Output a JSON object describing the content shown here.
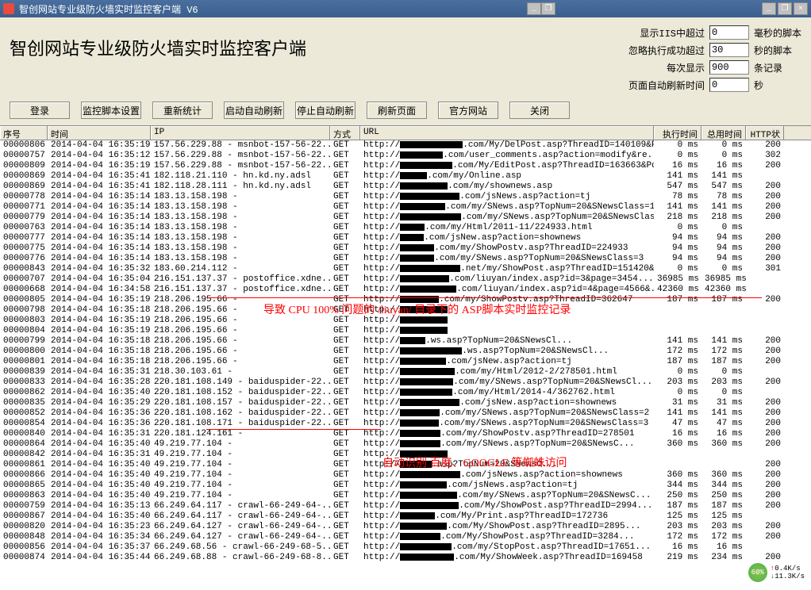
{
  "window": {
    "title": "智创网站专业级防火墙实时监控客户端  V6",
    "minimize": "_",
    "restore": "❐",
    "close": "×",
    "float_min": "_",
    "float_rest": "❐"
  },
  "header": {
    "title": "智创网站专业级防火墙实时监控客户端"
  },
  "settings": {
    "r1_label": "显示IIS中超过",
    "r1_value": "0",
    "r1_unit": "毫秒的脚本",
    "r2_label": "忽略执行成功超过",
    "r2_value": "30",
    "r2_unit": "秒的脚本",
    "r3_label": "每次显示",
    "r3_value": "900",
    "r3_unit": "条记录",
    "r4_label": "页面自动刷新时间",
    "r4_value": "0",
    "r4_unit": "秒"
  },
  "toolbar": {
    "login": "登录",
    "script": "监控脚本设置",
    "restat": "重新统计",
    "startauto": "启动自动刷新",
    "stopauto": "停止自动刷新",
    "refresh": "刷新页面",
    "site": "官方网站",
    "close": "关闭"
  },
  "columns": {
    "seq": "序号",
    "time": "时间",
    "ip": "IP",
    "method": "方式",
    "url": "URL",
    "exec": "执行时间",
    "total": "总用时间",
    "status": "HTTP状"
  },
  "annotations": {
    "note1": "导致 CPU 100% 问题的 /liuyan/ 目录下的 ASP脚本实时监控记录",
    "note2": "自动识别 百度、GOOGLE 等蜘蛛访问"
  },
  "badge": {
    "pct": "60%",
    "up": "0.4K/s",
    "down": "11.3K/s"
  },
  "rows": [
    {
      "seq": "00000806",
      "time": "2014-04-04 16:35:19",
      "ip": "157.56.229.88 - msnbot-157-56-22...",
      "m": "GET",
      "url": "com/My/DelPost.asp?ThreadID=140109&Pag...",
      "e": "0 ms",
      "t": "0 ms",
      "s": "200"
    },
    {
      "seq": "00000757",
      "time": "2014-04-04 16:35:12",
      "ip": "157.56.229.88 - msnbot-157-56-22...",
      "m": "GET",
      "url": "com/user_comments.asp?action=modify&re...",
      "e": "0 ms",
      "t": "0 ms",
      "s": "302"
    },
    {
      "seq": "00000809",
      "time": "2014-04-04 16:35:19",
      "ip": "157.56.229.88 - msnbot-157-56-22...",
      "m": "GET",
      "url": "com/My/EditPost.asp?ThreadID=163663&Po...",
      "e": "16 ms",
      "t": "16 ms",
      "s": "200"
    },
    {
      "seq": "00000869",
      "time": "2014-04-04 16:35:41",
      "ip": "182.118.21.110 - hn.kd.ny.adsl",
      "m": "GET",
      "url": "com/my/Online.asp",
      "e": "141 ms",
      "t": "141 ms",
      "s": ""
    },
    {
      "seq": "00000869",
      "time": "2014-04-04 16:35:41",
      "ip": "182.118.28.111 - hn.kd.ny.adsl",
      "m": "GET",
      "url": "com/my/shownews.asp",
      "e": "547 ms",
      "t": "547 ms",
      "s": "200"
    },
    {
      "seq": "00000778",
      "time": "2014-04-04 16:35:14",
      "ip": "183.13.158.198 -",
      "m": "GET",
      "url": "com/jsNews.asp?action=tj",
      "e": "78 ms",
      "t": "78 ms",
      "s": "200"
    },
    {
      "seq": "00000771",
      "time": "2014-04-04 16:35:14",
      "ip": "183.13.158.198 -",
      "m": "GET",
      "url": "com/my/SNews.asp?TopNum=20&SNewsClass=1",
      "e": "141 ms",
      "t": "141 ms",
      "s": "200"
    },
    {
      "seq": "00000779",
      "time": "2014-04-04 16:35:14",
      "ip": "183.13.158.198 -",
      "m": "GET",
      "url": "com/my/SNews.asp?TopNum=20&SNewsClass=2",
      "e": "218 ms",
      "t": "218 ms",
      "s": "200"
    },
    {
      "seq": "00000763",
      "time": "2014-04-04 16:35:14",
      "ip": "183.13.158.198 -",
      "m": "GET",
      "url": "com/my/Html/2011-11/224933.html",
      "e": "0 ms",
      "t": "0 ms",
      "s": ""
    },
    {
      "seq": "00000777",
      "time": "2014-04-04 16:35:14",
      "ip": "183.13.158.198 -",
      "m": "GET",
      "url": "com/jsNew.asp?action=shownews",
      "e": "94 ms",
      "t": "94 ms",
      "s": "200"
    },
    {
      "seq": "00000775",
      "time": "2014-04-04 16:35:14",
      "ip": "183.13.158.198 -",
      "m": "GET",
      "url": "com/my/ShowPostv.asp?ThreadID=224933",
      "e": "94 ms",
      "t": "94 ms",
      "s": "200"
    },
    {
      "seq": "00000776",
      "time": "2014-04-04 16:35:14",
      "ip": "183.13.158.198 -",
      "m": "GET",
      "url": "com/my/SNews.asp?TopNum=20&SNewsClass=3",
      "e": "94 ms",
      "t": "94 ms",
      "s": "200"
    },
    {
      "seq": "00000843",
      "time": "2014-04-04 16:35:32",
      "ip": "183.60.214.112 -",
      "m": "GET",
      "url": "net/my/ShowPost.asp?ThreadID=151420&G...",
      "e": "0 ms",
      "t": "0 ms",
      "s": "301"
    },
    {
      "seq": "00000707",
      "time": "2014-04-04 16:35:04",
      "ip": "216.151.137.37 - postoffice.xdne...",
      "m": "GET",
      "url": "com/liuyan/index.asp?id=3&page=3454...",
      "e": "36985 ms",
      "t": "36985 ms",
      "s": ""
    },
    {
      "seq": "00000668",
      "time": "2014-04-04 16:34:58",
      "ip": "216.151.137.37 - postoffice.xdne...",
      "m": "GET",
      "url": "com/liuyan/index.asp?id=4&page=4566&...",
      "e": "42360 ms",
      "t": "42360 ms",
      "s": ""
    },
    {
      "seq": "00000805",
      "time": "2014-04-04 16:35:19",
      "ip": "218.206.195.66 -",
      "m": "GET",
      "url": "com/my/ShowPostv.asp?ThreadID=362647",
      "e": "187 ms",
      "t": "187 ms",
      "s": "200"
    },
    {
      "seq": "00000798",
      "time": "2014-04-04 16:35:18",
      "ip": "218.206.195.66 -",
      "m": "GET",
      "url": "",
      "e": "",
      "t": "",
      "s": ""
    },
    {
      "seq": "00000803",
      "time": "2014-04-04 16:35:19",
      "ip": "218.206.195.66 -",
      "m": "GET",
      "url": "",
      "e": "",
      "t": "",
      "s": ""
    },
    {
      "seq": "00000804",
      "time": "2014-04-04 16:35:19",
      "ip": "218.206.195.66 -",
      "m": "GET",
      "url": "",
      "e": "",
      "t": "",
      "s": ""
    },
    {
      "seq": "00000799",
      "time": "2014-04-04 16:35:18",
      "ip": "218.206.195.66 -",
      "m": "GET",
      "url": "ws.asp?TopNum=20&SNewsCl...",
      "e": "141 ms",
      "t": "141 ms",
      "s": "200"
    },
    {
      "seq": "00000800",
      "time": "2014-04-04 16:35:18",
      "ip": "218.206.195.66 -",
      "m": "GET",
      "url": "ws.asp?TopNum=20&SNewsCl...",
      "e": "172 ms",
      "t": "172 ms",
      "s": "200"
    },
    {
      "seq": "00000801",
      "time": "2014-04-04 16:35:18",
      "ip": "218.206.195.66 -",
      "m": "GET",
      "url": "com/jsNew.asp?action=tj",
      "e": "187 ms",
      "t": "187 ms",
      "s": "200"
    },
    {
      "seq": "00000839",
      "time": "2014-04-04 16:35:31",
      "ip": "218.30.103.61 -",
      "m": "GET",
      "url": "com/my/Html/2012-2/278501.html",
      "e": "0 ms",
      "t": "0 ms",
      "s": ""
    },
    {
      "seq": "00000833",
      "time": "2014-04-04 16:35:28",
      "ip": "220.181.108.149 - baiduspider-22...",
      "m": "GET",
      "url": "com/my/SNews.asp?TopNum=20&SNewsCl...",
      "e": "203 ms",
      "t": "203 ms",
      "s": "200"
    },
    {
      "seq": "00000862",
      "time": "2014-04-04 16:35:40",
      "ip": "220.181.108.152 - baiduspider-22...",
      "m": "GET",
      "url": "com/my/Html/2014-4/362762.html",
      "e": "0 ms",
      "t": "0 ms",
      "s": ""
    },
    {
      "seq": "00000835",
      "time": "2014-04-04 16:35:29",
      "ip": "220.181.108.157 - baiduspider-22...",
      "m": "GET",
      "url": "com/jsNew.asp?action=shownews",
      "e": "31 ms",
      "t": "31 ms",
      "s": "200"
    },
    {
      "seq": "00000852",
      "time": "2014-04-04 16:35:36",
      "ip": "220.181.108.162 - baiduspider-22...",
      "m": "GET",
      "url": "com/my/SNews.asp?TopNum=20&SNewsClass=2",
      "e": "141 ms",
      "t": "141 ms",
      "s": "200"
    },
    {
      "seq": "00000854",
      "time": "2014-04-04 16:35:36",
      "ip": "220.181.108.171 - baiduspider-22...",
      "m": "GET",
      "url": "com/my/SNews.asp?TopNum=20&SNewsClass=3",
      "e": "47 ms",
      "t": "47 ms",
      "s": "200"
    },
    {
      "seq": "00000840",
      "time": "2014-04-04 16:35:31",
      "ip": "220.181.124.161 -",
      "m": "GET",
      "url": "com/my/ShowPostv.asp?ThreadID=278501",
      "e": "16 ms",
      "t": "16 ms",
      "s": "200"
    },
    {
      "seq": "00000864",
      "time": "2014-04-04 16:35:40",
      "ip": "49.219.77.104 -",
      "m": "GET",
      "url": "com/my/SNews.asp?TopNum=20&SNewsC...",
      "e": "360 ms",
      "t": "360 ms",
      "s": "200"
    },
    {
      "seq": "00000842",
      "time": "2014-04-04 16:35:31",
      "ip": "49.219.77.104 -",
      "m": "GET",
      "url": "",
      "e": "",
      "t": "",
      "s": ""
    },
    {
      "seq": "00000861",
      "time": "2014-04-04 16:35:40",
      "ip": "49.219.77.104 -",
      "m": "GET",
      "url": "asp?TopNum=20&SNewsC...",
      "e": "",
      "t": "",
      "s": "200"
    },
    {
      "seq": "00000866",
      "time": "2014-04-04 16:35:40",
      "ip": "49.219.77.104 -",
      "m": "GET",
      "url": "com/jsNews.asp?action=shownews",
      "e": "360 ms",
      "t": "360 ms",
      "s": "200"
    },
    {
      "seq": "00000865",
      "time": "2014-04-04 16:35:40",
      "ip": "49.219.77.104 -",
      "m": "GET",
      "url": "com/jsNews.asp?action=tj",
      "e": "344 ms",
      "t": "344 ms",
      "s": "200"
    },
    {
      "seq": "00000863",
      "time": "2014-04-04 16:35:40",
      "ip": "49.219.77.104 -",
      "m": "GET",
      "url": "com/my/SNews.asp?TopNum=20&SNewsC...",
      "e": "250 ms",
      "t": "250 ms",
      "s": "200"
    },
    {
      "seq": "00000759",
      "time": "2014-04-04 16:35:13",
      "ip": "66.249.64.117 - crawl-66-249-64-...",
      "m": "GET",
      "url": "com/My/ShowPost.asp?ThreadID=2994...",
      "e": "187 ms",
      "t": "187 ms",
      "s": "200"
    },
    {
      "seq": "00000867",
      "time": "2014-04-04 16:35:40",
      "ip": "66.249.64.117 - crawl-66-249-64-...",
      "m": "GET",
      "url": "com/My/Print.asp?ThreadID=172736",
      "e": "125 ms",
      "t": "125 ms",
      "s": ""
    },
    {
      "seq": "00000820",
      "time": "2014-04-04 16:35:23",
      "ip": "66.249.64.127 - crawl-66-249-64-...",
      "m": "GET",
      "url": "com/My/ShowPost.asp?ThreadID=2895...",
      "e": "203 ms",
      "t": "203 ms",
      "s": "200"
    },
    {
      "seq": "00000848",
      "time": "2014-04-04 16:35:34",
      "ip": "66.249.64.127 - crawl-66-249-64-...",
      "m": "GET",
      "url": "com/My/ShowPost.asp?ThreadID=3284...",
      "e": "172 ms",
      "t": "172 ms",
      "s": "200"
    },
    {
      "seq": "00000856",
      "time": "2014-04-04 16:35:37",
      "ip": "66.249.68.56 - crawl-66-249-68-5...",
      "m": "GET",
      "url": "com/my/StopPost.asp?ThreadID=17651...",
      "e": "16 ms",
      "t": "16 ms",
      "s": ""
    },
    {
      "seq": "00000874",
      "time": "2014-04-04 16:35:44",
      "ip": "66.249.68.88 - crawl-66-249-68-8...",
      "m": "GET",
      "url": "com/My/ShowWeek.asp?ThreadID=169458",
      "e": "219 ms",
      "t": "234 ms",
      "s": "200"
    }
  ]
}
